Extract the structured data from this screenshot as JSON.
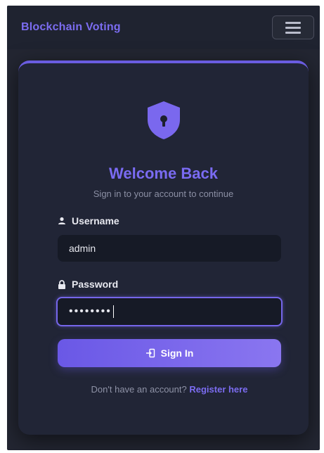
{
  "navbar": {
    "brand": "Blockchain Voting",
    "menu_icon": "hamburger-icon"
  },
  "login": {
    "icon": "shield-lock-icon",
    "title": "Welcome Back",
    "subtitle": "Sign in to your account to continue",
    "username_label": "Username",
    "username_icon": "user-icon",
    "username_value": "admin",
    "password_label": "Password",
    "password_icon": "lock-icon",
    "password_value": "••••••••",
    "submit_label": "Sign In",
    "submit_icon": "sign-in-icon",
    "register_prompt": "Don't have an account?",
    "register_link": "Register here"
  },
  "colors": {
    "accent": "#7B6CF0",
    "background": "#232632",
    "card": "#212536",
    "input": "#161A26"
  }
}
